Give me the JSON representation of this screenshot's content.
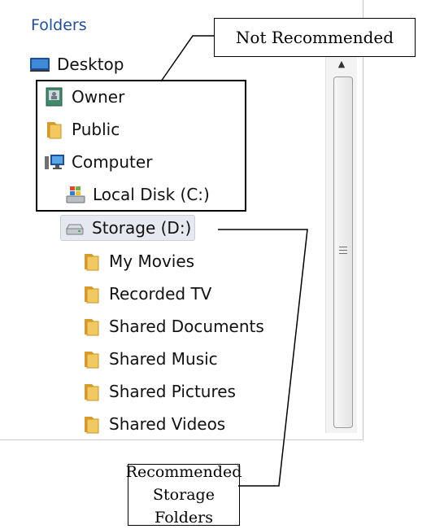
{
  "pane": {
    "header": "Folders"
  },
  "tree": [
    {
      "label": "Desktop",
      "icon": "desktop-icon"
    },
    {
      "label": "Owner",
      "icon": "user-folder-icon"
    },
    {
      "label": "Public",
      "icon": "folder-icon"
    },
    {
      "label": "Computer",
      "icon": "computer-icon"
    },
    {
      "label": "Local Disk (C:)",
      "icon": "local-disk-icon"
    },
    {
      "label": "Storage (D:)",
      "icon": "drive-icon"
    },
    {
      "label": "My Movies",
      "icon": "folder-icon"
    },
    {
      "label": "Recorded TV",
      "icon": "folder-icon"
    },
    {
      "label": "Shared Documents",
      "icon": "folder-icon"
    },
    {
      "label": "Shared Music",
      "icon": "folder-icon"
    },
    {
      "label": "Shared Pictures",
      "icon": "folder-icon"
    },
    {
      "label": "Shared Videos",
      "icon": "folder-icon"
    }
  ],
  "callouts": {
    "not_recommended": "Not Recommended",
    "recommended_line1": "Recommended",
    "recommended_line2": "Storage Folders"
  },
  "colors": {
    "header": "#1e4f9c",
    "folder": "#e8b84a",
    "selection": "#e6eaf0"
  }
}
